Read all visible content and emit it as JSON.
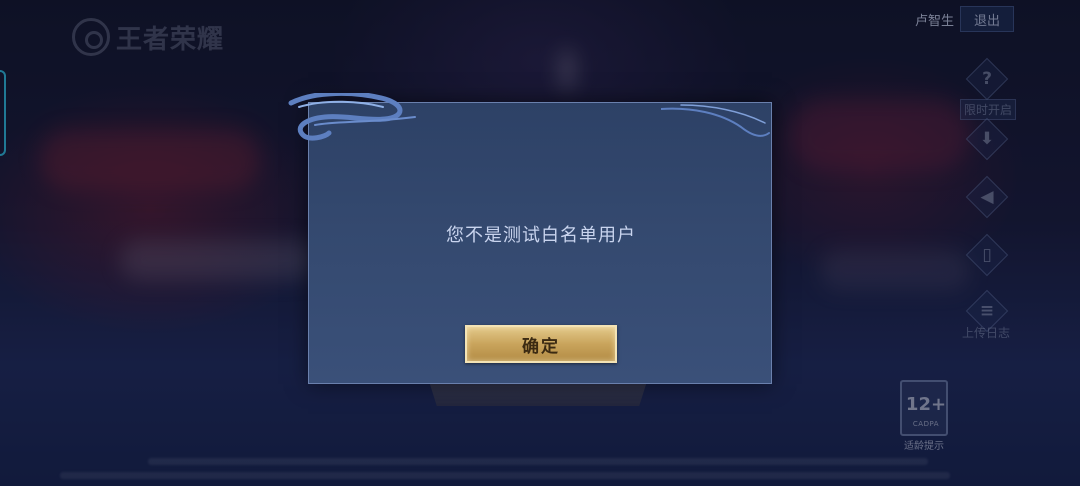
{
  "app": {
    "logo_text": "王者荣耀"
  },
  "header": {
    "username": "卢智生",
    "logout_label": "退出"
  },
  "side_menu": {
    "limited_open_label": "限时开启",
    "upload_log_label": "上传日志",
    "items": [
      {
        "icon": "help-icon",
        "glyph": "?"
      },
      {
        "icon": "download-icon",
        "glyph": "⬇"
      },
      {
        "icon": "sound-icon",
        "glyph": "◀"
      },
      {
        "icon": "phone-icon",
        "glyph": "▯"
      },
      {
        "icon": "log-icon",
        "glyph": "≡"
      }
    ]
  },
  "age_badge": {
    "rating": "12+",
    "org": "CADPA",
    "hint": "适龄提示"
  },
  "dialog": {
    "message": "您不是测试白名单用户",
    "confirm_label": "确定"
  },
  "colors": {
    "dialog_bg": "#34496f",
    "confirm_gold": "#c9a45c",
    "accent_cyan": "#2fb6d8"
  }
}
